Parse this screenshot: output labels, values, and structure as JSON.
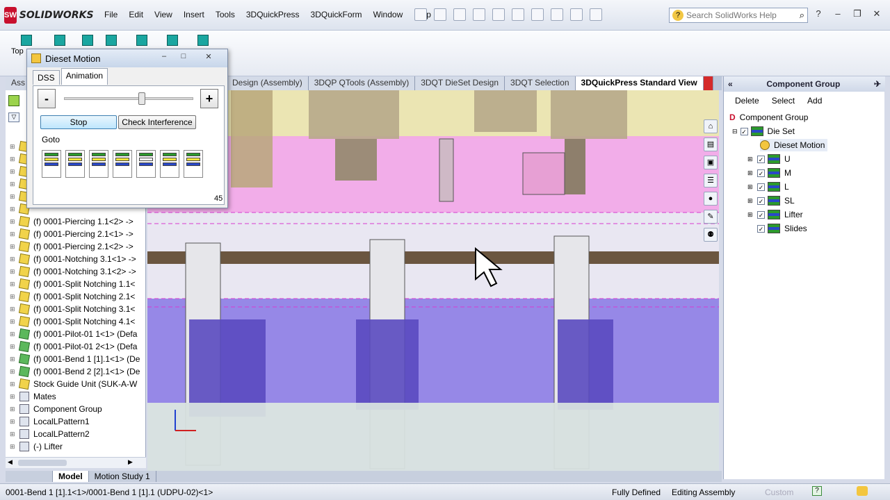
{
  "app": {
    "logo_text": "SOLIDWORKS",
    "menus": [
      "File",
      "Edit",
      "View",
      "Insert",
      "Tools",
      "3DQuickPress",
      "3DQuickForm",
      "Window",
      "Help"
    ],
    "search_placeholder": "Search SolidWorks Help",
    "top_label": "Top"
  },
  "doc_tabs": [
    {
      "label": "Ass",
      "active": false
    },
    {
      "label": "Design (Assembly)",
      "active": false
    },
    {
      "label": "3DQP QTools (Assembly)",
      "active": false
    },
    {
      "label": "3DQT DieSet Design",
      "active": false
    },
    {
      "label": "3DQT Selection",
      "active": false
    },
    {
      "label": "3DQuickPress Standard View",
      "active": true
    }
  ],
  "dialog": {
    "title": "Dieset Motion",
    "tabs": [
      "DSS",
      "Animation"
    ],
    "active_tab": "Animation",
    "minus_label": "-",
    "plus_label": "+",
    "slider_value": 0.6,
    "stop_label": "Stop",
    "check_label": "Check Interference",
    "goto_label": "Goto",
    "counter": "45"
  },
  "feature_tree": [
    {
      "label": "(f) 0001-Piercing 1.1<2> ->",
      "icon": "part-icon"
    },
    {
      "label": "(f) 0001-Piercing 2.1<1> ->",
      "icon": "part-icon"
    },
    {
      "label": "(f) 0001-Piercing 2.1<2> ->",
      "icon": "part-icon"
    },
    {
      "label": "(f) 0001-Notching 3.1<1> ->",
      "icon": "part-icon"
    },
    {
      "label": "(f) 0001-Notching 3.1<2> ->",
      "icon": "part-icon"
    },
    {
      "label": "(f) 0001-Split Notching 1.1<",
      "icon": "part-icon"
    },
    {
      "label": "(f) 0001-Split Notching 2.1<",
      "icon": "part-icon"
    },
    {
      "label": "(f) 0001-Split Notching 3.1<",
      "icon": "part-icon"
    },
    {
      "label": "(f) 0001-Split Notching 4.1<",
      "icon": "part-icon"
    },
    {
      "label": "(f) 0001-Pilot-01 1<1> (Defa",
      "icon": "green-part-icon"
    },
    {
      "label": "(f) 0001-Pilot-01 2<1> (Defa",
      "icon": "green-part-icon"
    },
    {
      "label": "(f) 0001-Bend 1 [1].1<1> (De",
      "icon": "green-part-icon"
    },
    {
      "label": "(f) 0001-Bend 2 [2].1<1> (De",
      "icon": "green-part-icon"
    },
    {
      "label": "Stock Guide Unit (SUK-A-W",
      "icon": "part-icon"
    },
    {
      "label": "Mates",
      "icon": "mates-icon"
    },
    {
      "label": "Component Group",
      "icon": "group-icon"
    },
    {
      "label": "LocalLPattern1",
      "icon": "pattern-icon"
    },
    {
      "label": "LocalLPattern2",
      "icon": "pattern-icon"
    },
    {
      "label": "(-) Lifter",
      "icon": "sketch-icon"
    }
  ],
  "component_group": {
    "title": "Component Group",
    "actions": [
      "Delete",
      "Select",
      "Add"
    ],
    "root": "Component Group",
    "die_set": "Die Set",
    "dieset_motion": "Dieset Motion",
    "children": [
      "U",
      "M",
      "L",
      "SL",
      "Lifter",
      "Slides"
    ]
  },
  "bottom_tabs": [
    {
      "label": "Model",
      "active": true
    },
    {
      "label": "Motion Study 1",
      "active": false
    }
  ],
  "status": {
    "selection": "0001-Bend 1 [1].1<1>/0001-Bend 1 [1].1 (UDPU-02)<1>",
    "state": "Fully Defined",
    "mode": "Editing Assembly",
    "custom": "Custom"
  },
  "colors": {
    "accent": "#c8102e",
    "upper_die": "#f2a6e6",
    "lower_die": "#8a7ae6",
    "die_top": "#e8e0a6"
  }
}
